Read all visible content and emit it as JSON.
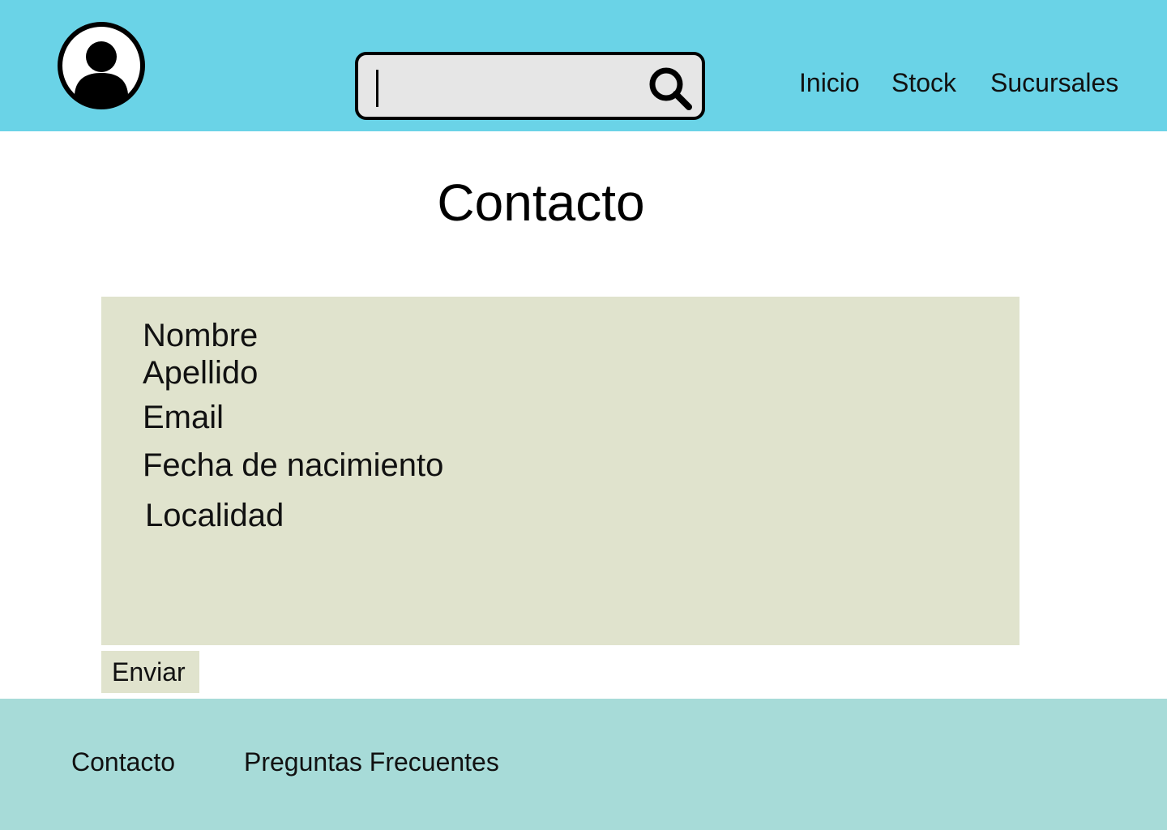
{
  "header": {
    "avatar_icon": "user-account-icon",
    "search": {
      "value": "",
      "placeholder": "",
      "icon": "search-icon"
    },
    "nav": [
      {
        "label": "Inicio"
      },
      {
        "label": "Stock"
      },
      {
        "label": "Sucursales"
      }
    ]
  },
  "main": {
    "title": "Contacto",
    "form": {
      "fields": [
        {
          "label": "Nombre"
        },
        {
          "label": "Apellido"
        },
        {
          "label": "Email"
        },
        {
          "label": "Fecha de nacimiento"
        },
        {
          "label": "Localidad"
        }
      ],
      "submit_label": "Enviar"
    }
  },
  "footer": {
    "links": [
      {
        "label": "Contacto"
      },
      {
        "label": "Preguntas Frecuentes"
      }
    ]
  },
  "colors": {
    "header_bg": "#6ad3e7",
    "form_bg": "#e0e3cd",
    "footer_bg": "#a7dbd8",
    "search_bg": "#e6e6e6"
  }
}
